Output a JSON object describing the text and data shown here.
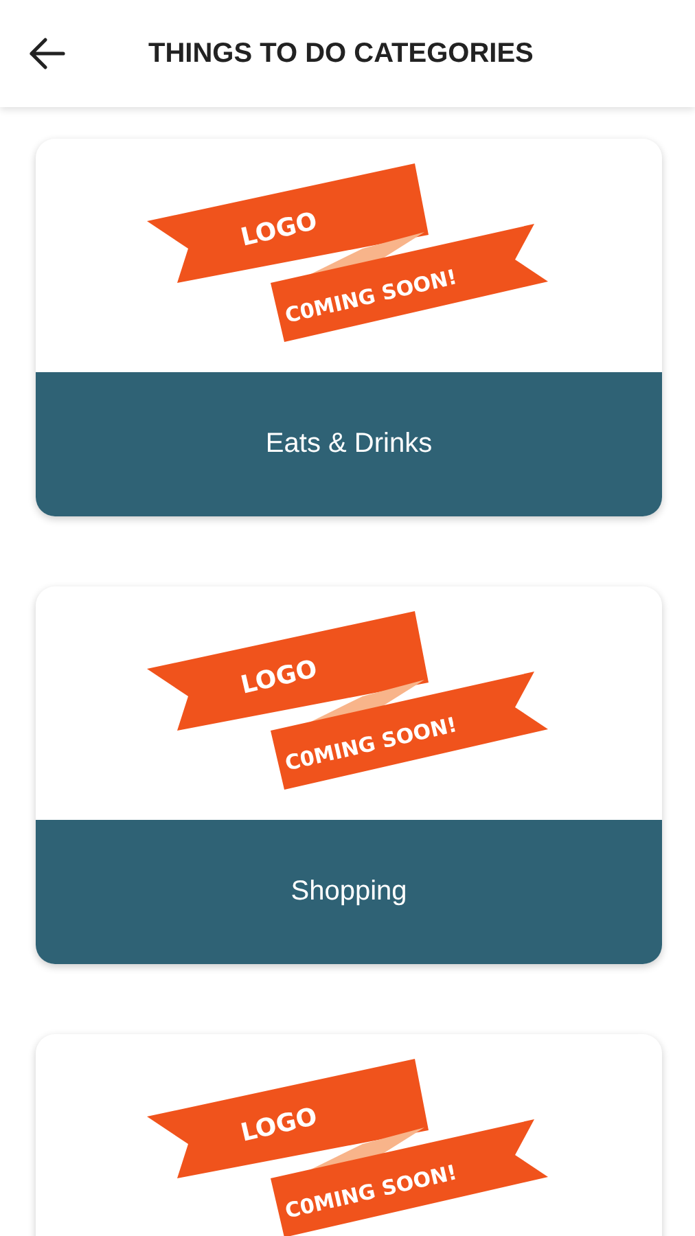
{
  "header": {
    "title": "THINGS TO DO CATEGORIES"
  },
  "categories": [
    {
      "logo": {
        "top_text": "LOGO",
        "bottom_text": "C0MING SOON!"
      },
      "label": "Eats & Drinks"
    },
    {
      "logo": {
        "top_text": "LOGO",
        "bottom_text": "C0MING SOON!"
      },
      "label": "Shopping"
    },
    {
      "logo": {
        "top_text": "LOGO",
        "bottom_text": "C0MING SOON!"
      }
    }
  ]
}
